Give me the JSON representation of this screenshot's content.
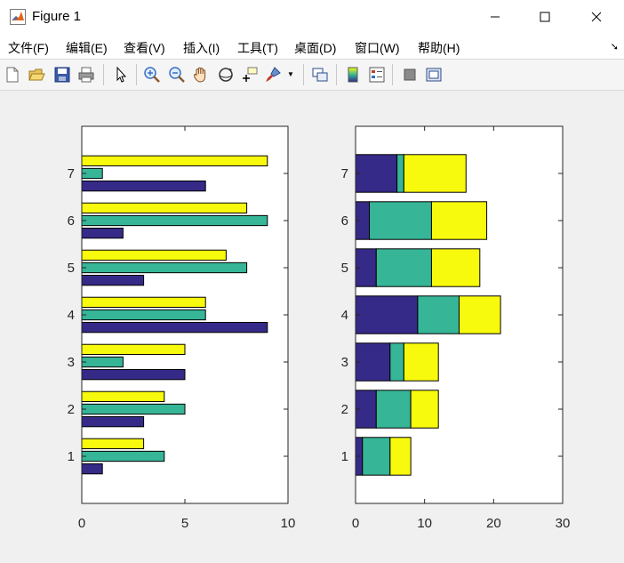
{
  "window": {
    "title": "Figure 1"
  },
  "menu": [
    "文件(F)",
    "编辑(E)",
    "查看(V)",
    "插入(I)",
    "工具(T)",
    "桌面(D)",
    "窗口(W)",
    "帮助(H)"
  ],
  "toolbar_icons": [
    "new-figure-icon",
    "open-file-icon",
    "save-icon",
    "print-icon",
    "pointer-icon",
    "zoom-in-icon",
    "zoom-out-icon",
    "pan-hand-icon",
    "rotate-3d-icon",
    "data-cursor-icon",
    "brush-icon",
    "link-plot-icon",
    "colorbar-icon",
    "legend-icon",
    "hide-plot-tools-icon",
    "show-plot-tools-icon"
  ],
  "colors": {
    "series1": "#352a87",
    "series2": "#36b597",
    "series3": "#f8fa0d"
  },
  "chart_data": [
    {
      "type": "bar",
      "orientation": "horizontal",
      "grouped": true,
      "categories": [
        "1",
        "2",
        "3",
        "4",
        "5",
        "6",
        "7"
      ],
      "series": [
        {
          "values": [
            1,
            3,
            5,
            9,
            3,
            2,
            6
          ]
        },
        {
          "values": [
            4,
            5,
            2,
            6,
            8,
            9,
            1
          ]
        },
        {
          "values": [
            3,
            4,
            5,
            6,
            7,
            8,
            9
          ]
        }
      ],
      "xlim": [
        0,
        10
      ],
      "xticks": [
        "0",
        "5",
        "10"
      ],
      "ylim": [
        0,
        8
      ],
      "yticks": [
        "1",
        "2",
        "3",
        "4",
        "5",
        "6",
        "7"
      ]
    },
    {
      "type": "bar",
      "orientation": "horizontal",
      "stacked": true,
      "categories": [
        "1",
        "2",
        "3",
        "4",
        "5",
        "6",
        "7"
      ],
      "series": [
        {
          "values": [
            1,
            3,
            5,
            9,
            3,
            2,
            6
          ]
        },
        {
          "values": [
            4,
            5,
            2,
            6,
            8,
            9,
            1
          ]
        },
        {
          "values": [
            3,
            4,
            5,
            6,
            7,
            8,
            9
          ]
        }
      ],
      "xlim": [
        0,
        30
      ],
      "xticks": [
        "0",
        "10",
        "20",
        "30"
      ],
      "ylim": [
        0,
        8
      ],
      "yticks": [
        "1",
        "2",
        "3",
        "4",
        "5",
        "6",
        "7"
      ]
    }
  ]
}
